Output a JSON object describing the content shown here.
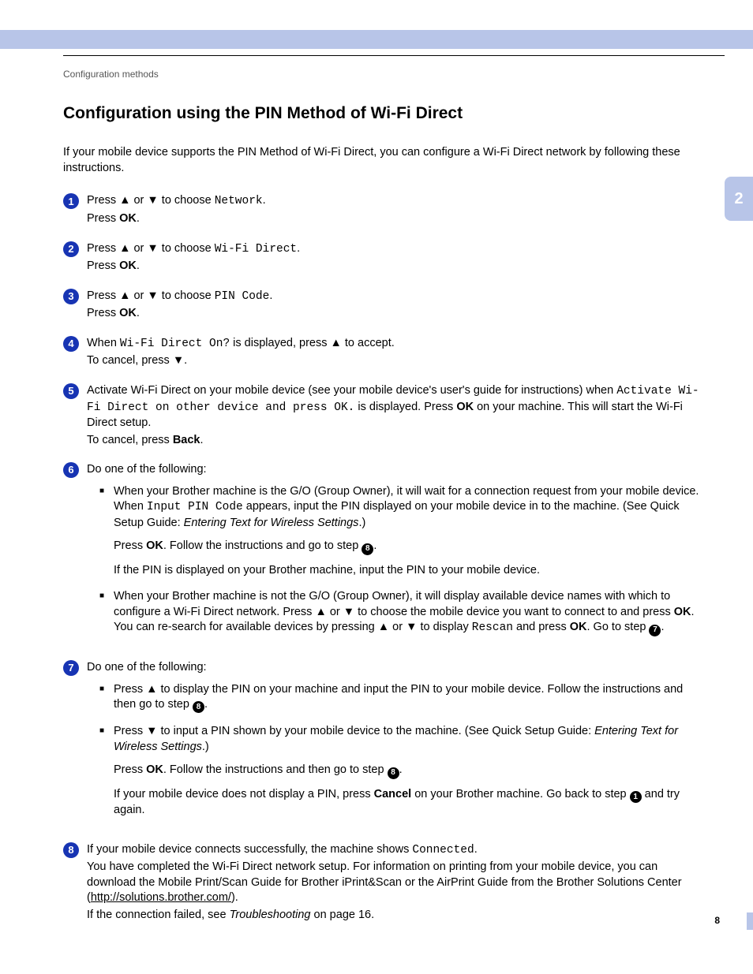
{
  "breadcrumb": "Configuration methods",
  "side_tab": "2",
  "page_number": "8",
  "heading": "Configuration using the PIN Method of Wi-Fi Direct",
  "intro": "If your mobile device supports the PIN Method of Wi-Fi Direct, you can configure a Wi-Fi Direct network by following these instructions.",
  "glyphs": {
    "up": "▲",
    "down": "▼"
  },
  "labels": {
    "press": "Press ",
    "or": " or ",
    "to_choose": " to choose ",
    "press_ok": "Press ",
    "ok": "OK",
    "period": ".",
    "back": "Back",
    "cancel": "Cancel",
    "network": "Network",
    "wifi_direct": "Wi-Fi Direct",
    "pin_code": "PIN Code",
    "wifi_direct_on": "Wi-Fi Direct On?",
    "activate_msg": "Activate Wi-Fi Direct on other device and press OK.",
    "input_pin_code": "Input PIN Code",
    "rescan": "Rescan",
    "connected": "Connected",
    "quick_setup_ref": "Entering Text for Wireless Settings",
    "troubleshooting": "Troubleshooting",
    "solutions_url": "http://solutions.brother.com/"
  },
  "step4": {
    "l1a": "When ",
    "l1b": " is displayed, press ",
    "l1c": " to accept.",
    "l2a": "To cancel, press ",
    "l2b": "."
  },
  "step5": {
    "l1": "Activate Wi-Fi Direct on your mobile device (see your mobile device's user's guide for instructions) when ",
    "l2a": " is displayed. Press ",
    "l2b": " on your machine. This will start the Wi-Fi Direct setup.",
    "l3a": "To cancel, press ",
    "l3b": "."
  },
  "step6": {
    "lead": "Do one of the following:",
    "b1p1a": "When your Brother machine is the G/O (Group Owner), it will wait for a connection request from your mobile device. When ",
    "b1p1b": " appears, input the PIN displayed on your mobile device in to the machine. (See Quick Setup Guide: ",
    "b1p1c": ".)",
    "b1p2a": "Press ",
    "b1p2b": ". Follow the instructions and go to step ",
    "b1p2c": ".",
    "b1p3": "If the PIN is displayed on your Brother machine, input the PIN to your mobile device.",
    "b2p1a": "When your Brother machine is not the G/O (Group Owner), it will display available device names with which to configure a Wi-Fi Direct network. Press ",
    "b2p1b": " to choose the mobile device you want to connect to and press ",
    "b2p1c": ". You can re-search for available devices by pressing ",
    "b2p1d": " to display ",
    "b2p1e": " and press ",
    "b2p1f": ". Go to step ",
    "b2p1g": "."
  },
  "step7": {
    "lead": "Do one of the following:",
    "b1p1a": "Press ",
    "b1p1b": " to display the PIN on your machine and input the PIN to your mobile device. Follow the instructions and then go to step ",
    "b1p1c": ".",
    "b2p1a": "Press ",
    "b2p1b": " to input a PIN shown by your mobile device to the machine. (See Quick Setup Guide: ",
    "b2p1c": ".)",
    "b2p2a": "Press ",
    "b2p2b": ". Follow the instructions and then go to step ",
    "b2p2c": ".",
    "b2p3a": "If your mobile device does not display a PIN, press ",
    "b2p3b": " on your Brother machine. Go back to step ",
    "b2p3c": " and try again."
  },
  "step8": {
    "l1a": "If your mobile device connects successfully, the machine shows ",
    "l1b": ".",
    "l2": "You have completed the Wi-Fi Direct network setup. For information on printing from your mobile device, you can download the Mobile Print/Scan Guide for Brother iPrint&Scan or the AirPrint Guide from the Brother Solutions Center (",
    "l2b": ").",
    "l3a": "If the connection failed, see ",
    "l3b": " on page 16."
  }
}
